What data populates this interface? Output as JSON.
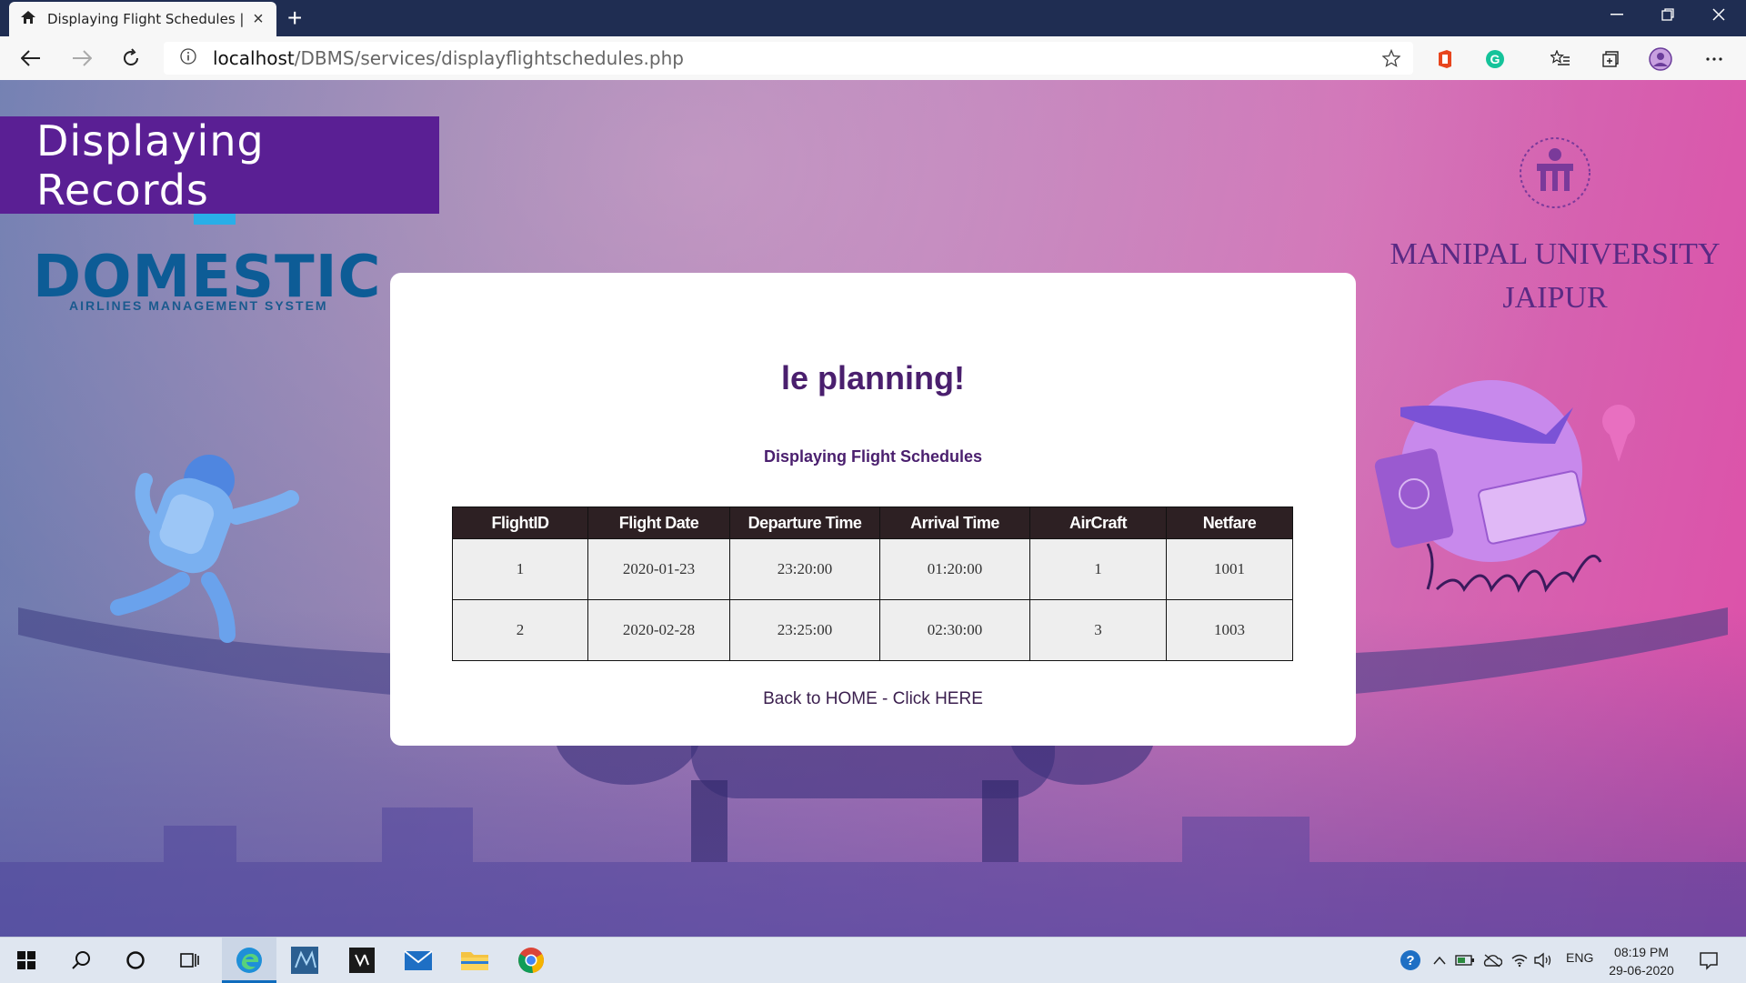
{
  "browser": {
    "tab_title": "Displaying Flight Schedules | DAMS",
    "new_tab_label": "+",
    "url_host": "localhost",
    "url_path": "/DBMS/services/displayflightschedules.php"
  },
  "page": {
    "banner_title": "Displaying Records",
    "brand_name": "DOMESTIC",
    "brand_tagline": "AIRLINES MANAGEMENT SYSTEM",
    "university_line1": "MANIPAL UNIVERSITY",
    "university_line2": "JAIPUR",
    "card": {
      "heading": "le planning!",
      "subtitle": "Displaying Flight Schedules",
      "home_link": "Back to HOME - Click HERE"
    },
    "table": {
      "headers": [
        "FlightID",
        "Flight Date",
        "Departure Time",
        "Arrival Time",
        "AirCraft",
        "Netfare"
      ],
      "rows": [
        [
          "1",
          "2020-01-23",
          "23:20:00",
          "01:20:00",
          "1",
          "1001"
        ],
        [
          "2",
          "2020-02-28",
          "23:25:00",
          "02:30:00",
          "3",
          "1003"
        ]
      ]
    }
  },
  "taskbar": {
    "language": "ENG",
    "time": "08:19 PM",
    "date": "29-06-2020"
  },
  "colors": {
    "banner": "#5a1f94",
    "heading": "#4a1f6e",
    "table_header": "#2d2023",
    "brand": "#0d5c96"
  }
}
